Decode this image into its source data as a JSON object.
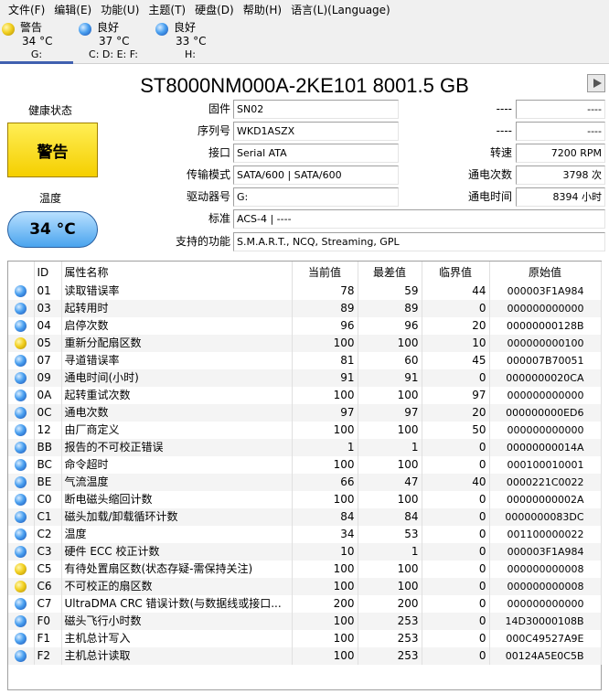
{
  "menu": [
    "文件(F)",
    "编辑(E)",
    "功能(U)",
    "主题(T)",
    "硬盘(D)",
    "帮助(H)",
    "语言(L)(Language)"
  ],
  "disks": [
    {
      "status": "警告",
      "temp": "34 °C",
      "drives": "G:",
      "color": "yellow"
    },
    {
      "status": "良好",
      "temp": "37 °C",
      "drives": "C: D: E: F:",
      "color": "blue"
    },
    {
      "status": "良好",
      "temp": "33 °C",
      "drives": "H:",
      "color": "blue"
    }
  ],
  "title": "ST8000NM000A-2KE101 8001.5 GB",
  "health": {
    "label": "健康状态",
    "value": "警告"
  },
  "temperature": {
    "label": "温度",
    "value": "34 °C"
  },
  "fields": {
    "firmware": {
      "label": "固件",
      "value": "SN02"
    },
    "serial": {
      "label": "序列号",
      "value": "WKD1ASZX"
    },
    "interface": {
      "label": "接口",
      "value": "Serial ATA"
    },
    "transfer": {
      "label": "传输模式",
      "value": "SATA/600 | SATA/600"
    },
    "drive_letter": {
      "label": "驱动器号",
      "value": "G:"
    },
    "standard": {
      "label": "标准",
      "value": "ACS-4 | ----"
    },
    "features": {
      "label": "支持的功能",
      "value": "S.M.A.R.T., NCQ, Streaming, GPL"
    },
    "right1_label": "----",
    "right1_value": "----",
    "right2_label": "----",
    "right2_value": "----",
    "rpm": {
      "label": "转速",
      "value": "7200 RPM"
    },
    "power_count": {
      "label": "通电次数",
      "value": "3798 次"
    },
    "power_hours": {
      "label": "通电时间",
      "value": "8394 小时"
    }
  },
  "table": {
    "headers": [
      "ID",
      "属性名称",
      "当前值",
      "最差值",
      "临界值",
      "原始值"
    ],
    "rows": [
      {
        "id": "01",
        "name": "读取错误率",
        "cur": "78",
        "worst": "59",
        "thr": "44",
        "raw": "000003F1A984",
        "color": "blue"
      },
      {
        "id": "03",
        "name": "起转用时",
        "cur": "89",
        "worst": "89",
        "thr": "0",
        "raw": "000000000000",
        "color": "blue"
      },
      {
        "id": "04",
        "name": "启停次数",
        "cur": "96",
        "worst": "96",
        "thr": "20",
        "raw": "00000000128B",
        "color": "blue"
      },
      {
        "id": "05",
        "name": "重新分配扇区数",
        "cur": "100",
        "worst": "100",
        "thr": "10",
        "raw": "000000000100",
        "color": "yellow"
      },
      {
        "id": "07",
        "name": "寻道错误率",
        "cur": "81",
        "worst": "60",
        "thr": "45",
        "raw": "000007B70051",
        "color": "blue"
      },
      {
        "id": "09",
        "name": "通电时间(小时)",
        "cur": "91",
        "worst": "91",
        "thr": "0",
        "raw": "0000000020CA",
        "color": "blue"
      },
      {
        "id": "0A",
        "name": "起转重试次数",
        "cur": "100",
        "worst": "100",
        "thr": "97",
        "raw": "000000000000",
        "color": "blue"
      },
      {
        "id": "0C",
        "name": "通电次数",
        "cur": "97",
        "worst": "97",
        "thr": "20",
        "raw": "000000000ED6",
        "color": "blue"
      },
      {
        "id": "12",
        "name": "由厂商定义",
        "cur": "100",
        "worst": "100",
        "thr": "50",
        "raw": "000000000000",
        "color": "blue"
      },
      {
        "id": "BB",
        "name": "报告的不可校正错误",
        "cur": "1",
        "worst": "1",
        "thr": "0",
        "raw": "00000000014A",
        "color": "blue"
      },
      {
        "id": "BC",
        "name": "命令超时",
        "cur": "100",
        "worst": "100",
        "thr": "0",
        "raw": "000100010001",
        "color": "blue"
      },
      {
        "id": "BE",
        "name": "气流温度",
        "cur": "66",
        "worst": "47",
        "thr": "40",
        "raw": "0000221C0022",
        "color": "blue"
      },
      {
        "id": "C0",
        "name": "断电磁头缩回计数",
        "cur": "100",
        "worst": "100",
        "thr": "0",
        "raw": "00000000002A",
        "color": "blue"
      },
      {
        "id": "C1",
        "name": "磁头加载/卸载循环计数",
        "cur": "84",
        "worst": "84",
        "thr": "0",
        "raw": "0000000083DC",
        "color": "blue"
      },
      {
        "id": "C2",
        "name": "温度",
        "cur": "34",
        "worst": "53",
        "thr": "0",
        "raw": "001100000022",
        "color": "blue"
      },
      {
        "id": "C3",
        "name": "硬件 ECC 校正计数",
        "cur": "10",
        "worst": "1",
        "thr": "0",
        "raw": "000003F1A984",
        "color": "blue"
      },
      {
        "id": "C5",
        "name": "有待处置扇区数(状态存疑-需保持关注)",
        "cur": "100",
        "worst": "100",
        "thr": "0",
        "raw": "000000000008",
        "color": "yellow"
      },
      {
        "id": "C6",
        "name": "不可校正的扇区数",
        "cur": "100",
        "worst": "100",
        "thr": "0",
        "raw": "000000000008",
        "color": "yellow"
      },
      {
        "id": "C7",
        "name": "UltraDMA CRC 错误计数(与数据线或接口...",
        "cur": "200",
        "worst": "200",
        "thr": "0",
        "raw": "000000000000",
        "color": "blue"
      },
      {
        "id": "F0",
        "name": "磁头飞行小时数",
        "cur": "100",
        "worst": "253",
        "thr": "0",
        "raw": "14D30000108B",
        "color": "blue"
      },
      {
        "id": "F1",
        "name": "主机总计写入",
        "cur": "100",
        "worst": "253",
        "thr": "0",
        "raw": "000C49527A9E",
        "color": "blue"
      },
      {
        "id": "F2",
        "name": "主机总计读取",
        "cur": "100",
        "worst": "253",
        "thr": "0",
        "raw": "00124A5E0C5B",
        "color": "blue"
      }
    ]
  }
}
